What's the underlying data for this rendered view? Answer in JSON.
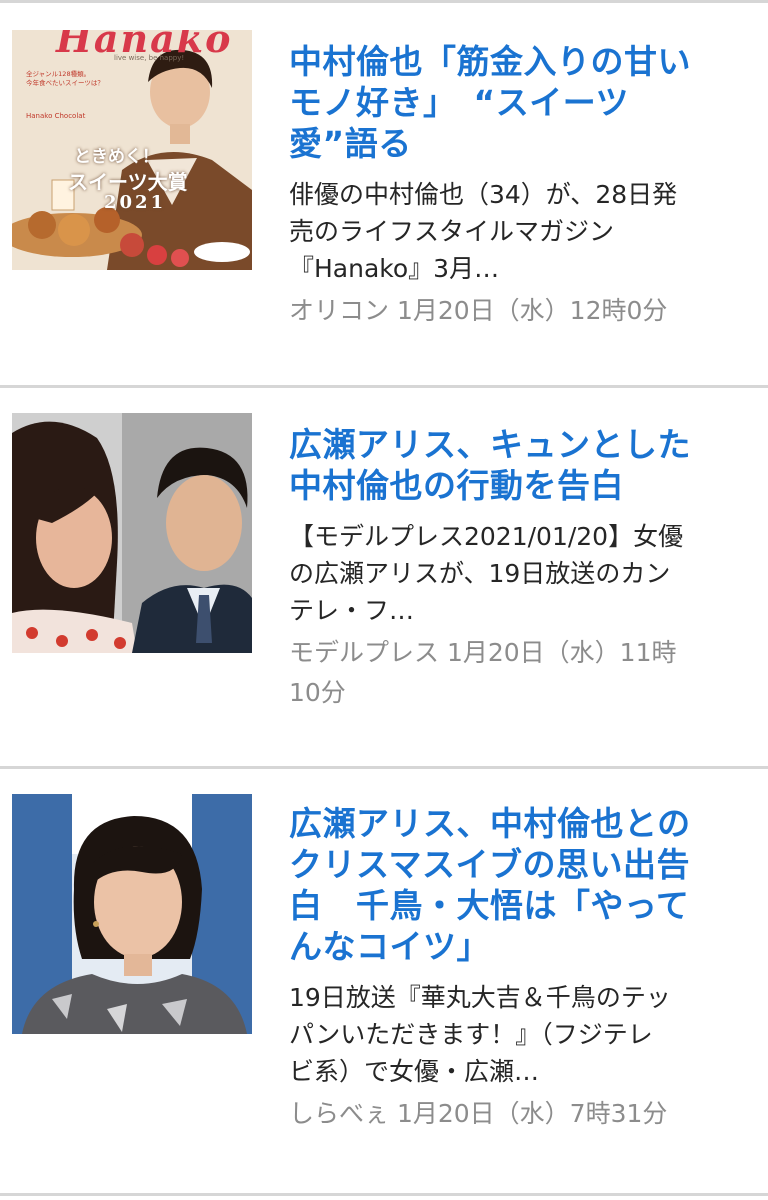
{
  "articles": [
    {
      "headline": "中村倫也「筋金入りの甘い\nモノ好き」　“スイーツ\n愛”語る",
      "snippet": "俳優の中村倫也（34）が、28日発\n売のライフスタイルマガジン\n『Hanako』3月…",
      "source": "オリコン",
      "date": "1月20日（水）12時0分",
      "thumb": {
        "type": "magazine-cover",
        "masthead": "Hanako",
        "tagline": "live wise, be happy!",
        "cover_line_1": "ときめく！",
        "cover_line_2": "スイーツ大賞",
        "cover_year": "2021",
        "cover_blurb": "全ジャンル128種類。\n今年食べたいスイーツは？",
        "cover_side": "Hanako Chocolat"
      }
    },
    {
      "headline": "広瀬アリス、キュンとした\n中村倫也の行動を告白",
      "snippet": "【モデルプレス2021/01/20】女優\nの広瀬アリスが、19日放送のカン\nテレ・フ…",
      "source": "モデルプレス",
      "date": "1月20日（水）11時\n10分",
      "thumb": {
        "type": "photo-two-people"
      }
    },
    {
      "headline": "広瀬アリス、中村倫也との\nクリスマスイブの思い出告\n白　千鳥・大悟は「やって\nんなコイツ」",
      "snippet": "19日放送『華丸大吉＆千鳥のテッ\nパンいただきます！』（フジテレ\nビ系）で女優・広瀬…",
      "source": "しらべぇ",
      "date": "1月20日（水）7時31分",
      "thumb": {
        "type": "photo-woman-portrait"
      }
    }
  ],
  "colors": {
    "headline": "#1a73d1",
    "snippet": "#262626",
    "meta": "#8c8c8c",
    "divider": "#d6d6d6"
  }
}
